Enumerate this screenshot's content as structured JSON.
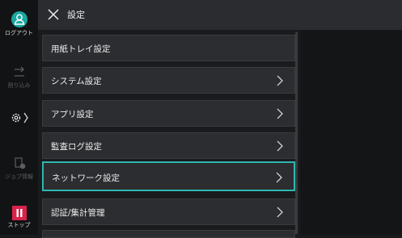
{
  "header": {
    "title": "設定"
  },
  "rail": {
    "logout_label": "ログアウト",
    "interrupt_label": "割り込み",
    "job_label": "ジョブ情報",
    "stop_label": "ストップ"
  },
  "menu": {
    "items": [
      {
        "label": "用紙トレイ設定",
        "has_chevron": false
      },
      {
        "label": "システム設定",
        "has_chevron": true
      },
      {
        "label": "アプリ設定",
        "has_chevron": true
      },
      {
        "label": "監査ログ設定",
        "has_chevron": true
      },
      {
        "label": "ネットワーク設定",
        "has_chevron": true,
        "selected": true
      },
      {
        "label": "認証/集計管理",
        "has_chevron": true
      }
    ]
  },
  "colors": {
    "accent": "#2fb7b0",
    "logout": "#1aa7a0",
    "stop": "#d8234c"
  }
}
